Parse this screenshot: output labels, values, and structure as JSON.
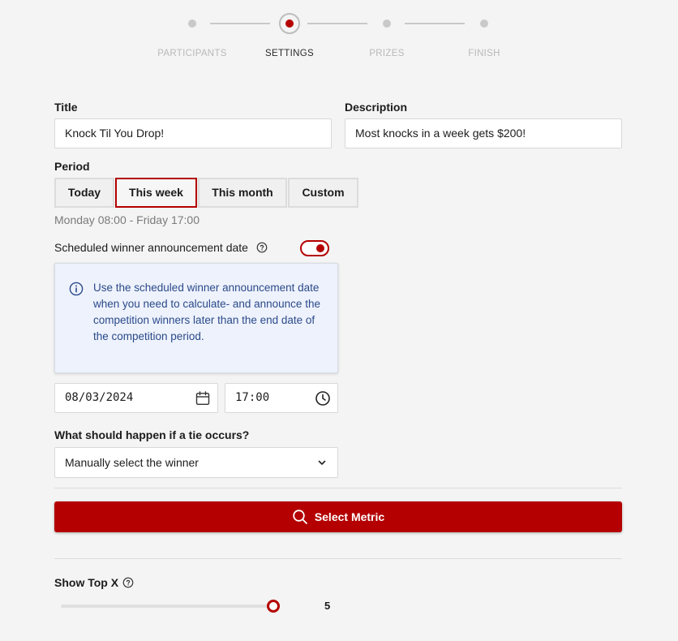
{
  "stepper": {
    "steps": [
      {
        "label": "PARTICIPANTS",
        "active": false
      },
      {
        "label": "SETTINGS",
        "active": true
      },
      {
        "label": "PRIZES",
        "active": false
      },
      {
        "label": "FINISH",
        "active": false
      }
    ]
  },
  "form": {
    "title_label": "Title",
    "title_value": "Knock Til You Drop!",
    "description_label": "Description",
    "description_value": "Most knocks in a week gets $200!",
    "period_label": "Period",
    "period_options": [
      "Today",
      "This week",
      "This month",
      "Custom"
    ],
    "period_selected": "This week",
    "period_range": "Monday 08:00 - Friday 17:00",
    "announcement_label": "Scheduled winner announcement date",
    "announcement_enabled": true,
    "info_text": "Use the scheduled winner announcement date when you need to calculate- and announce the competition winners later than the end date of the competition period.",
    "date_value": "08/03/2024",
    "time_value": "17:00",
    "tie_label": "What should happen if a tie occurs?",
    "tie_value": "Manually select the winner",
    "select_metric_label": "Select Metric",
    "show_top_label": "Show Top X",
    "show_top_value": "5"
  },
  "colors": {
    "accent": "#b40000",
    "info_bg": "#eef2fc",
    "info_text": "#2a4a8a"
  },
  "icons": [
    "help-circle-icon",
    "info-icon",
    "calendar-icon",
    "clock-icon",
    "chevron-down-icon",
    "search-icon"
  ]
}
